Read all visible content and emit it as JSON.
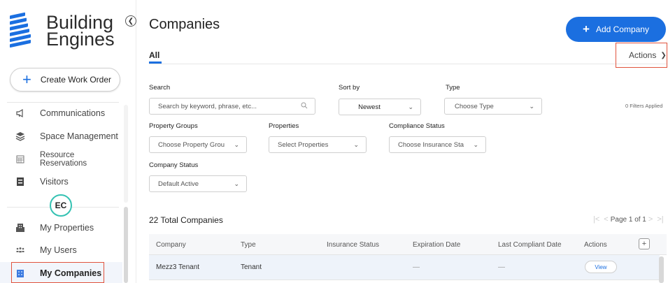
{
  "brand": {
    "line1": "Building",
    "line2": "Engines",
    "color": "#1b6fe0"
  },
  "sidebar": {
    "create_label": "Create Work Order",
    "items": [
      {
        "label": "Communications",
        "icon": "megaphone-icon"
      },
      {
        "label": "Space Management",
        "icon": "layers-icon"
      },
      {
        "label_line1": "Resource",
        "label_line2": "Reservations",
        "icon": "calendar-icon"
      },
      {
        "label": "Visitors",
        "icon": "badge-icon"
      },
      {
        "label": "My Properties",
        "icon": "building-icon"
      },
      {
        "label": "My Users",
        "icon": "users-icon"
      },
      {
        "label": "My Companies",
        "icon": "companies-icon",
        "active": true
      }
    ],
    "avatar_initials": "EC"
  },
  "header": {
    "title": "Companies",
    "add_button": "Add Company",
    "tab_all": "All",
    "actions_label": "Actions"
  },
  "filters": {
    "search_label": "Search",
    "search_placeholder": "Search by keyword, phrase, etc...",
    "sort_label": "Sort by",
    "sort_value": "Newest",
    "type_label": "Type",
    "type_value": "Choose Type",
    "filters_applied": "0 Filters Applied",
    "property_groups_label": "Property Groups",
    "property_groups_value": "Choose Property Grou",
    "properties_label": "Properties",
    "properties_value": "Select Properties",
    "compliance_label": "Compliance Status",
    "compliance_value": "Choose Insurance Sta",
    "company_status_label": "Company Status",
    "company_status_value": "Default Active"
  },
  "results": {
    "total": "22 Total Companies",
    "pager": "Page 1 of 1"
  },
  "table": {
    "columns": [
      "Company",
      "Type",
      "Insurance Status",
      "Expiration Date",
      "Last Compliant Date",
      "Actions"
    ],
    "rows": [
      {
        "company": "Mezz3 Tenant",
        "type": "Tenant",
        "insurance": "",
        "expiration": "—",
        "last_compliant": "—",
        "action": "View"
      }
    ]
  }
}
